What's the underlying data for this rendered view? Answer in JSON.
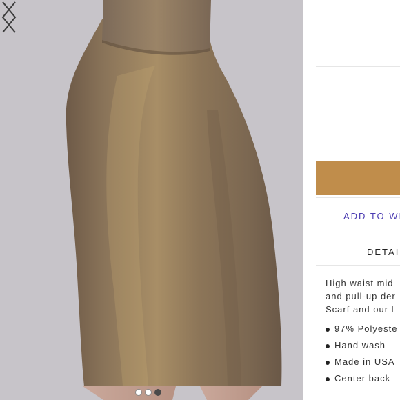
{
  "gallery": {
    "prev_icon": "chevron-left-icon",
    "next_icon": "chevron-right-icon",
    "image_count": 3,
    "active_index": 2
  },
  "panel": {
    "add_to_bag_color": "#c08d4b",
    "wishlist_label": "ADD TO WIS",
    "details_title": "DETAI",
    "description_lines": [
      "High waist mid",
      "and pull-up der",
      "Scarf and our l"
    ],
    "bullets": [
      "97% Polyeste",
      "Hand wash",
      "Made in USA",
      "Center back"
    ]
  },
  "colors": {
    "accent": "#c08d4b",
    "link": "#4b3bb2",
    "background": "#c7c4c9"
  }
}
